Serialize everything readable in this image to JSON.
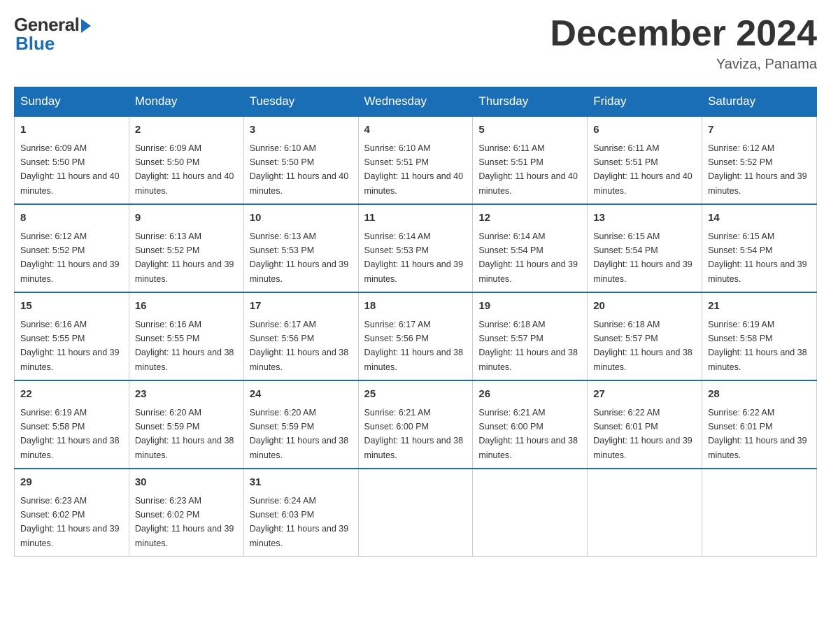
{
  "header": {
    "logo_general": "General",
    "logo_blue": "Blue",
    "month_title": "December 2024",
    "location": "Yaviza, Panama"
  },
  "days_of_week": [
    "Sunday",
    "Monday",
    "Tuesday",
    "Wednesday",
    "Thursday",
    "Friday",
    "Saturday"
  ],
  "weeks": [
    [
      {
        "day": "1",
        "sunrise": "6:09 AM",
        "sunset": "5:50 PM",
        "daylight": "11 hours and 40 minutes."
      },
      {
        "day": "2",
        "sunrise": "6:09 AM",
        "sunset": "5:50 PM",
        "daylight": "11 hours and 40 minutes."
      },
      {
        "day": "3",
        "sunrise": "6:10 AM",
        "sunset": "5:50 PM",
        "daylight": "11 hours and 40 minutes."
      },
      {
        "day": "4",
        "sunrise": "6:10 AM",
        "sunset": "5:51 PM",
        "daylight": "11 hours and 40 minutes."
      },
      {
        "day": "5",
        "sunrise": "6:11 AM",
        "sunset": "5:51 PM",
        "daylight": "11 hours and 40 minutes."
      },
      {
        "day": "6",
        "sunrise": "6:11 AM",
        "sunset": "5:51 PM",
        "daylight": "11 hours and 40 minutes."
      },
      {
        "day": "7",
        "sunrise": "6:12 AM",
        "sunset": "5:52 PM",
        "daylight": "11 hours and 39 minutes."
      }
    ],
    [
      {
        "day": "8",
        "sunrise": "6:12 AM",
        "sunset": "5:52 PM",
        "daylight": "11 hours and 39 minutes."
      },
      {
        "day": "9",
        "sunrise": "6:13 AM",
        "sunset": "5:52 PM",
        "daylight": "11 hours and 39 minutes."
      },
      {
        "day": "10",
        "sunrise": "6:13 AM",
        "sunset": "5:53 PM",
        "daylight": "11 hours and 39 minutes."
      },
      {
        "day": "11",
        "sunrise": "6:14 AM",
        "sunset": "5:53 PM",
        "daylight": "11 hours and 39 minutes."
      },
      {
        "day": "12",
        "sunrise": "6:14 AM",
        "sunset": "5:54 PM",
        "daylight": "11 hours and 39 minutes."
      },
      {
        "day": "13",
        "sunrise": "6:15 AM",
        "sunset": "5:54 PM",
        "daylight": "11 hours and 39 minutes."
      },
      {
        "day": "14",
        "sunrise": "6:15 AM",
        "sunset": "5:54 PM",
        "daylight": "11 hours and 39 minutes."
      }
    ],
    [
      {
        "day": "15",
        "sunrise": "6:16 AM",
        "sunset": "5:55 PM",
        "daylight": "11 hours and 39 minutes."
      },
      {
        "day": "16",
        "sunrise": "6:16 AM",
        "sunset": "5:55 PM",
        "daylight": "11 hours and 38 minutes."
      },
      {
        "day": "17",
        "sunrise": "6:17 AM",
        "sunset": "5:56 PM",
        "daylight": "11 hours and 38 minutes."
      },
      {
        "day": "18",
        "sunrise": "6:17 AM",
        "sunset": "5:56 PM",
        "daylight": "11 hours and 38 minutes."
      },
      {
        "day": "19",
        "sunrise": "6:18 AM",
        "sunset": "5:57 PM",
        "daylight": "11 hours and 38 minutes."
      },
      {
        "day": "20",
        "sunrise": "6:18 AM",
        "sunset": "5:57 PM",
        "daylight": "11 hours and 38 minutes."
      },
      {
        "day": "21",
        "sunrise": "6:19 AM",
        "sunset": "5:58 PM",
        "daylight": "11 hours and 38 minutes."
      }
    ],
    [
      {
        "day": "22",
        "sunrise": "6:19 AM",
        "sunset": "5:58 PM",
        "daylight": "11 hours and 38 minutes."
      },
      {
        "day": "23",
        "sunrise": "6:20 AM",
        "sunset": "5:59 PM",
        "daylight": "11 hours and 38 minutes."
      },
      {
        "day": "24",
        "sunrise": "6:20 AM",
        "sunset": "5:59 PM",
        "daylight": "11 hours and 38 minutes."
      },
      {
        "day": "25",
        "sunrise": "6:21 AM",
        "sunset": "6:00 PM",
        "daylight": "11 hours and 38 minutes."
      },
      {
        "day": "26",
        "sunrise": "6:21 AM",
        "sunset": "6:00 PM",
        "daylight": "11 hours and 38 minutes."
      },
      {
        "day": "27",
        "sunrise": "6:22 AM",
        "sunset": "6:01 PM",
        "daylight": "11 hours and 39 minutes."
      },
      {
        "day": "28",
        "sunrise": "6:22 AM",
        "sunset": "6:01 PM",
        "daylight": "11 hours and 39 minutes."
      }
    ],
    [
      {
        "day": "29",
        "sunrise": "6:23 AM",
        "sunset": "6:02 PM",
        "daylight": "11 hours and 39 minutes."
      },
      {
        "day": "30",
        "sunrise": "6:23 AM",
        "sunset": "6:02 PM",
        "daylight": "11 hours and 39 minutes."
      },
      {
        "day": "31",
        "sunrise": "6:24 AM",
        "sunset": "6:03 PM",
        "daylight": "11 hours and 39 minutes."
      },
      null,
      null,
      null,
      null
    ]
  ]
}
